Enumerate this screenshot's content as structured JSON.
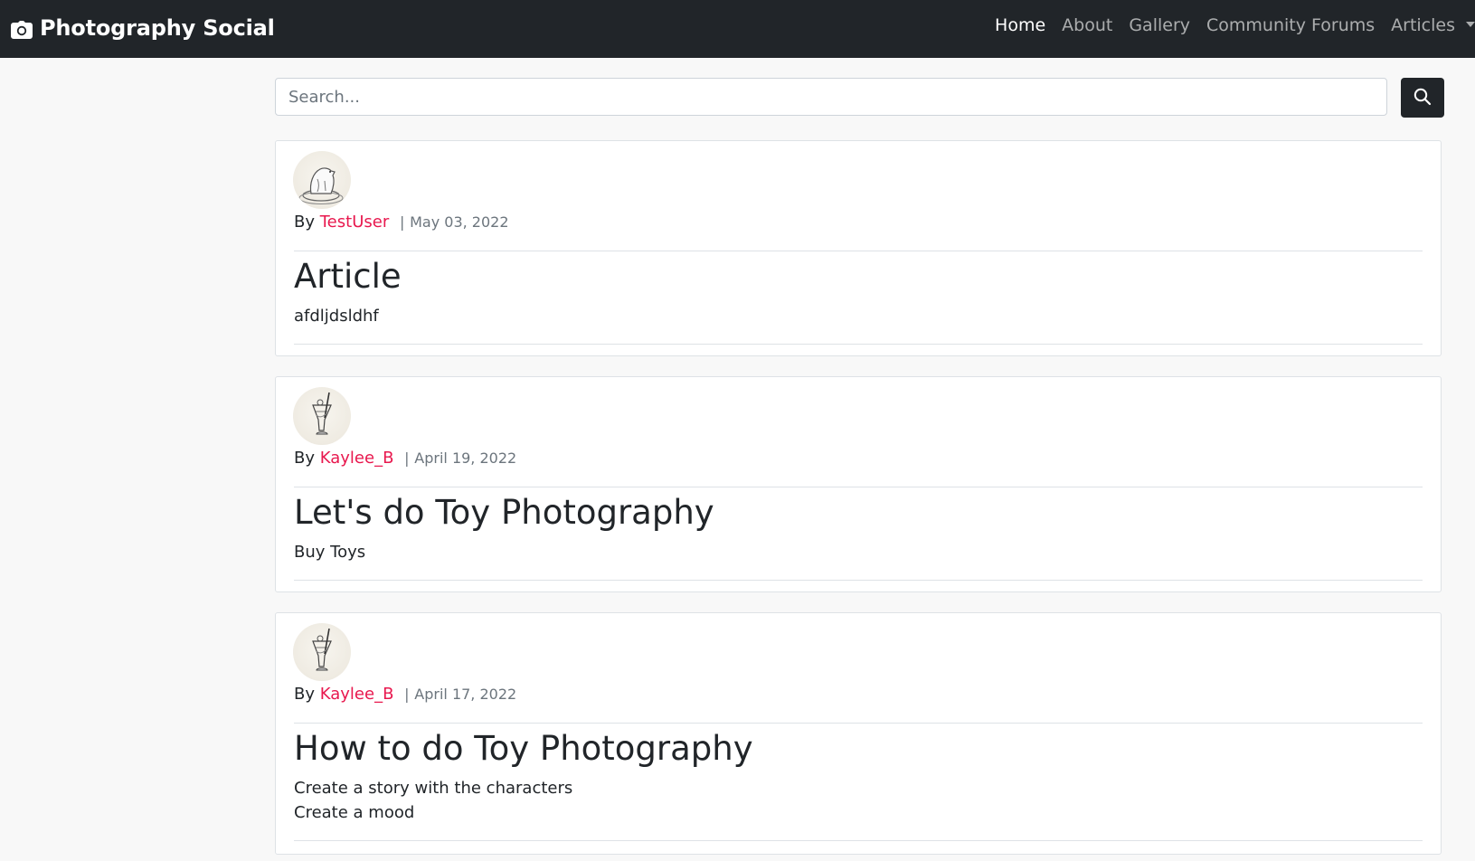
{
  "navbar": {
    "brand": "Photography Social",
    "links": {
      "home": "Home",
      "about": "About",
      "gallery": "Gallery",
      "forums": "Community Forums",
      "articles": "Articles"
    }
  },
  "search": {
    "placeholder": "Search..."
  },
  "articles": [
    {
      "by_label": "By",
      "author": "TestUser",
      "separator": "|",
      "date": "May 03, 2022",
      "title": "Article",
      "body": "afdljdsldhf",
      "avatar_icon": "polar-bear-avatar-icon"
    },
    {
      "by_label": "By",
      "author": "Kaylee_B",
      "separator": "|",
      "date": "April 19, 2022",
      "title": "Let's do Toy Photography",
      "body": "Buy Toys",
      "avatar_icon": "cocktail-glass-avatar-icon"
    },
    {
      "by_label": "By",
      "author": "Kaylee_B",
      "separator": "|",
      "date": "April 17, 2022",
      "title": "How to do Toy Photography",
      "body": "Create a story with the characters\nCreate a mood",
      "avatar_icon": "cocktail-glass-avatar-icon"
    }
  ],
  "colors": {
    "navbar_bg": "#212529",
    "author_link": "#e8184e",
    "page_bg": "#f8f8f8"
  }
}
